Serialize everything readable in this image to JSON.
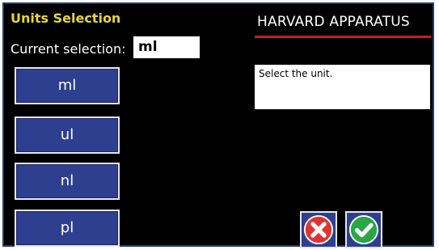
{
  "screen": {
    "title": "Units Selection",
    "current_selection_label": "Current selection:",
    "current_selection_value": "ml",
    "brand": "HARVARD APPARATUS",
    "prompt": "Select the unit."
  },
  "units": [
    {
      "label": "ml"
    },
    {
      "label": "ul"
    },
    {
      "label": "nl"
    },
    {
      "label": "pl"
    }
  ],
  "actions": {
    "cancel_icon": "cancel-x-icon",
    "confirm_icon": "confirm-check-icon"
  },
  "colors": {
    "background": "#000000",
    "title": "#e8d63a",
    "button": "#2f3f8f",
    "brand_underline": "#c21f1f",
    "cancel": "#e0342f",
    "confirm": "#27a844"
  }
}
